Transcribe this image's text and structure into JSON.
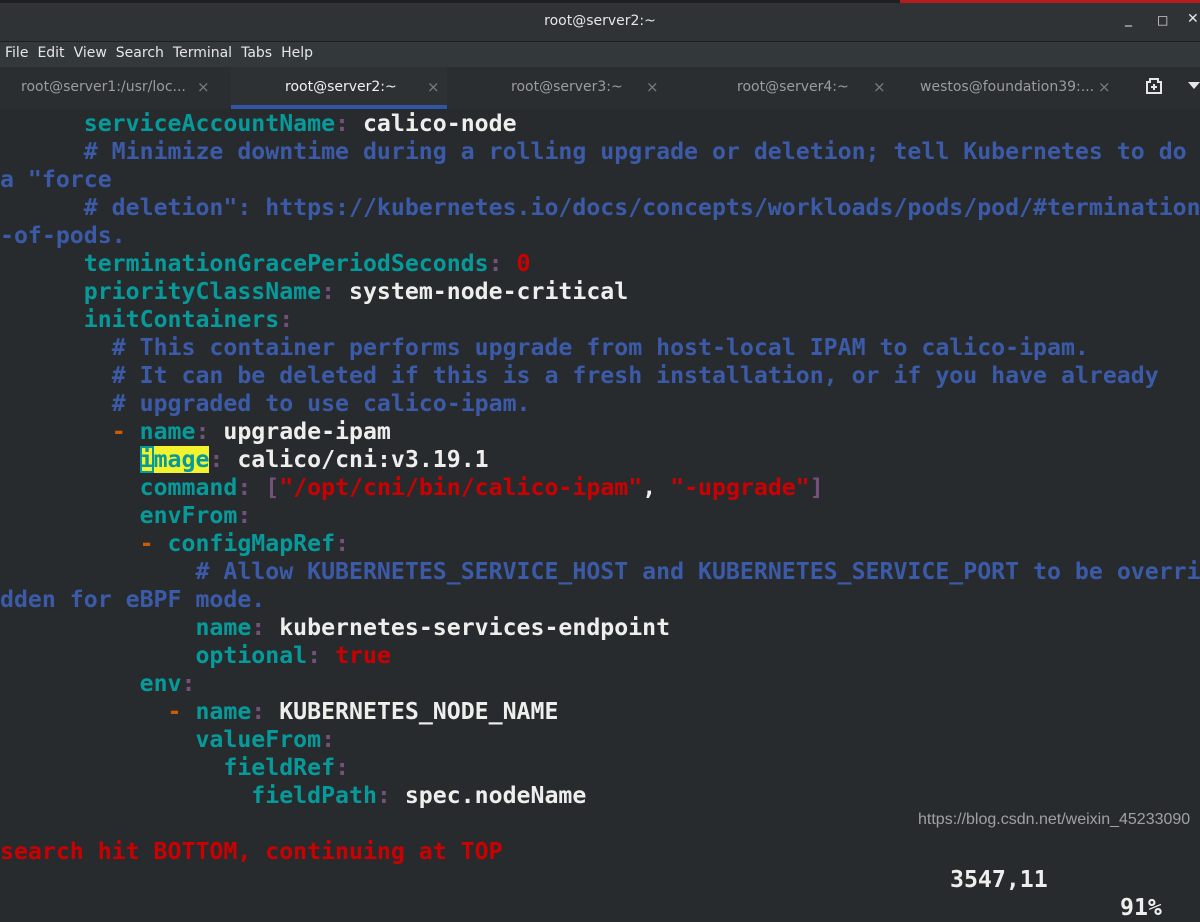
{
  "window": {
    "title": "root@server2:~",
    "minimize": "_",
    "maximize": "□",
    "close": "✕"
  },
  "menu": [
    "File",
    "Edit",
    "View",
    "Search",
    "Terminal",
    "Tabs",
    "Help"
  ],
  "tabs": [
    {
      "label": "root@server1:/usr/loc...",
      "active": false
    },
    {
      "label": "root@server2:~",
      "active": true
    },
    {
      "label": "root@server3:~",
      "active": false
    },
    {
      "label": "root@server4:~",
      "active": false
    },
    {
      "label": "westos@foundation39:...",
      "active": false
    }
  ],
  "tab_close": "×",
  "colors": {
    "key": "#079a9a",
    "comment": "#3b5aa8",
    "string": "#cc0000",
    "value": "#eeeeec",
    "punct": "#75507b",
    "dash": "#ce5c00",
    "search_highlight": "#f2f22e",
    "active_tab": "#2f55a4"
  },
  "lines": [
    [
      [
        "v",
        "      "
      ],
      [
        "k",
        "serviceAccountName"
      ],
      [
        "c",
        ": "
      ],
      [
        "v",
        "calico-node"
      ]
    ],
    [
      [
        "v",
        "      "
      ],
      [
        "cm",
        "# Minimize downtime during a rolling upgrade or deletion; tell Kubernetes to do "
      ]
    ],
    [
      [
        "cm",
        "a \"force"
      ]
    ],
    [
      [
        "v",
        "      "
      ],
      [
        "cm",
        "# deletion\": https://kubernetes.io/docs/concepts/workloads/pods/pod/#termination"
      ]
    ],
    [
      [
        "cm",
        "-of-pods."
      ]
    ],
    [
      [
        "v",
        "      "
      ],
      [
        "k",
        "terminationGracePeriodSeconds"
      ],
      [
        "c",
        ": "
      ],
      [
        "n",
        "0"
      ]
    ],
    [
      [
        "v",
        "      "
      ],
      [
        "k",
        "priorityClassName"
      ],
      [
        "c",
        ": "
      ],
      [
        "v",
        "system-node-critical"
      ]
    ],
    [
      [
        "v",
        "      "
      ],
      [
        "k",
        "initContainers"
      ],
      [
        "c",
        ":"
      ]
    ],
    [
      [
        "v",
        "        "
      ],
      [
        "cm",
        "# This container performs upgrade from host-local IPAM to calico-ipam."
      ]
    ],
    [
      [
        "v",
        "        "
      ],
      [
        "cm",
        "# It can be deleted if this is a fresh installation, or if you have already"
      ]
    ],
    [
      [
        "v",
        "        "
      ],
      [
        "cm",
        "# upgraded to use calico-ipam."
      ]
    ],
    [
      [
        "v",
        "        "
      ],
      [
        "d",
        "- "
      ],
      [
        "k",
        "name"
      ],
      [
        "c",
        ": "
      ],
      [
        "v",
        "upgrade-ipam"
      ]
    ],
    [
      [
        "v",
        "          "
      ],
      [
        "hlcur",
        "i"
      ],
      [
        "hl",
        "mage"
      ],
      [
        "c",
        ": "
      ],
      [
        "v",
        "calico/cni:v3.19.1"
      ]
    ],
    [
      [
        "v",
        "          "
      ],
      [
        "k",
        "command"
      ],
      [
        "c",
        ": "
      ],
      [
        "b",
        "["
      ],
      [
        "s",
        "\"/opt/cni/bin/calico-ipam\""
      ],
      [
        "v",
        ", "
      ],
      [
        "s",
        "\"-upgrade\""
      ],
      [
        "b",
        "]"
      ]
    ],
    [
      [
        "v",
        "          "
      ],
      [
        "k",
        "envFrom"
      ],
      [
        "c",
        ":"
      ]
    ],
    [
      [
        "v",
        "          "
      ],
      [
        "d",
        "- "
      ],
      [
        "k",
        "configMapRef"
      ],
      [
        "c",
        ":"
      ]
    ],
    [
      [
        "v",
        "              "
      ],
      [
        "cm",
        "# Allow KUBERNETES_SERVICE_HOST and KUBERNETES_SERVICE_PORT to be overri"
      ]
    ],
    [
      [
        "cm",
        "dden for eBPF mode."
      ]
    ],
    [
      [
        "v",
        "              "
      ],
      [
        "k",
        "name"
      ],
      [
        "c",
        ": "
      ],
      [
        "v",
        "kubernetes-services-endpoint"
      ]
    ],
    [
      [
        "v",
        "              "
      ],
      [
        "k",
        "optional"
      ],
      [
        "c",
        ": "
      ],
      [
        "s",
        "true"
      ]
    ],
    [
      [
        "v",
        "          "
      ],
      [
        "k",
        "env"
      ],
      [
        "c",
        ":"
      ]
    ],
    [
      [
        "v",
        "            "
      ],
      [
        "d",
        "- "
      ],
      [
        "k",
        "name"
      ],
      [
        "c",
        ": "
      ],
      [
        "v",
        "KUBERNETES_NODE_NAME"
      ]
    ],
    [
      [
        "v",
        "              "
      ],
      [
        "k",
        "valueFrom"
      ],
      [
        "c",
        ":"
      ]
    ],
    [
      [
        "v",
        "                "
      ],
      [
        "k",
        "fieldRef"
      ],
      [
        "c",
        ":"
      ]
    ],
    [
      [
        "v",
        "                  "
      ],
      [
        "k",
        "fieldPath"
      ],
      [
        "c",
        ": "
      ],
      [
        "v",
        "spec.nodeName"
      ]
    ]
  ],
  "status": {
    "message": "search hit BOTTOM, continuing at TOP",
    "position": "3547,11",
    "percent": "91%"
  },
  "watermark": "https://blog.csdn.net/weixin_45233090"
}
